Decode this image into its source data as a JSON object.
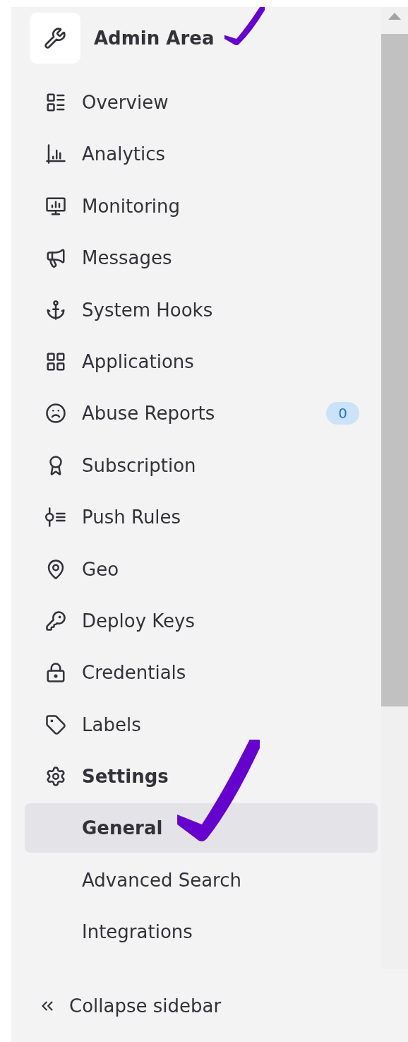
{
  "header": {
    "title": "Admin Area",
    "marked": true
  },
  "items": [
    {
      "label": "Overview",
      "selected": false
    },
    {
      "label": "Analytics",
      "selected": false
    },
    {
      "label": "Monitoring",
      "selected": false
    },
    {
      "label": "Messages",
      "selected": false
    },
    {
      "label": "System Hooks",
      "selected": false
    },
    {
      "label": "Applications",
      "selected": false
    },
    {
      "label": "Abuse Reports",
      "selected": false,
      "badge": "0"
    },
    {
      "label": "Subscription",
      "selected": false
    },
    {
      "label": "Push Rules",
      "selected": false
    },
    {
      "label": "Geo",
      "selected": false
    },
    {
      "label": "Deploy Keys",
      "selected": false
    },
    {
      "label": "Credentials",
      "selected": false
    },
    {
      "label": "Labels",
      "selected": false
    },
    {
      "label": "Settings",
      "selected": false,
      "expanded": true,
      "children": [
        {
          "label": "General",
          "selected": true,
          "marked": true
        },
        {
          "label": "Advanced Search",
          "selected": false,
          "marked": false
        },
        {
          "label": "Integrations",
          "selected": false,
          "marked": false
        }
      ]
    }
  ],
  "footer": {
    "label": "Collapse sidebar"
  }
}
